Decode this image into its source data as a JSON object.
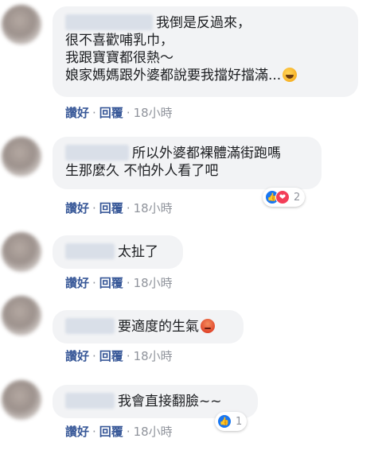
{
  "comments": [
    {
      "lines": [
        "我倒是反過來，",
        "很不喜歡哺乳巾，",
        "我跟寶寶都很熱～",
        "娘家媽媽跟外婆都說要我擋好擋滿..."
      ],
      "trailing_emoji": "laughing-emoji",
      "actions": {
        "like": "讚好",
        "reply": "回覆",
        "sep": "·",
        "time": "18小時"
      }
    },
    {
      "lines": [
        "所以外婆都裸體滿街跑嗎",
        "生那麼久 不怕外人看了吧"
      ],
      "actions": {
        "like": "讚好",
        "reply": "回覆",
        "sep": "·",
        "time": "18小時"
      },
      "reactions": {
        "icons": [
          "like-icon",
          "love-icon"
        ],
        "count": "2"
      }
    },
    {
      "lines": [
        "太扯了"
      ],
      "actions": {
        "like": "讚好",
        "reply": "回覆",
        "sep": "·",
        "time": "18小時"
      }
    },
    {
      "lines": [
        "要適度的生氣"
      ],
      "trailing_emoji": "angry-emoji",
      "actions": {
        "like": "讚好",
        "reply": "回覆",
        "sep": "·",
        "time": "18小時"
      }
    },
    {
      "lines": [
        "我會直接翻臉~~"
      ],
      "actions": {
        "like": "讚好",
        "reply": "回覆",
        "sep": "·",
        "time": "18小時"
      },
      "reactions": {
        "icons": [
          "like-icon"
        ],
        "count": "1"
      }
    }
  ],
  "colors": {
    "bubble": "#f2f3f5",
    "link": "#385898",
    "meta": "#90949c",
    "like": "#1877f2",
    "love": "#f33e58"
  }
}
